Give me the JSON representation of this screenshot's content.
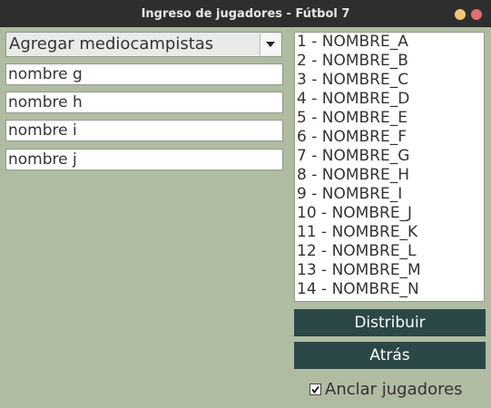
{
  "window": {
    "title": "Ingreso de jugadores - Fútbol 7"
  },
  "position_select": {
    "selected": "Agregar mediocampistas"
  },
  "name_fields": [
    {
      "value": "nombre g"
    },
    {
      "value": "nombre h"
    },
    {
      "value": "nombre i"
    },
    {
      "value": "nombre j"
    }
  ],
  "players_list": [
    "1 - NOMBRE_A",
    "2 - NOMBRE_B",
    "3 - NOMBRE_C",
    "4 - NOMBRE_D",
    "5 - NOMBRE_E",
    "6 - NOMBRE_F",
    "7 - NOMBRE_G",
    "8 - NOMBRE_H",
    "9 - NOMBRE_I",
    "10 - NOMBRE_J",
    "11 - NOMBRE_K",
    "12 - NOMBRE_L",
    "13 - NOMBRE_M",
    "14 - NOMBRE_N"
  ],
  "buttons": {
    "distribuir": "Distribuir",
    "atras": "Atrás"
  },
  "anchor_checkbox": {
    "label": "Anclar jugadores",
    "checked": true
  },
  "colors": {
    "background": "#b0bca2",
    "button": "#2b4747",
    "titlebar": "#2e2e2e"
  }
}
